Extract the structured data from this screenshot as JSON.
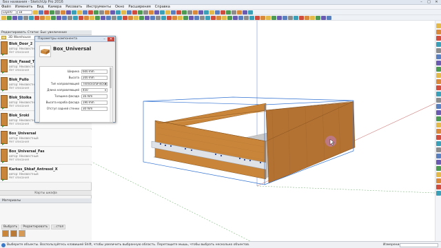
{
  "window": {
    "title": "Без названия - SketchUp Pro 2016",
    "controls": [
      "–",
      "□",
      "✕"
    ]
  },
  "menu": [
    "Файл",
    "Изменить",
    "Вид",
    "Камера",
    "Рисовать",
    "Инструменты",
    "Окно",
    "Расширения",
    "Справка"
  ],
  "toolbar": {
    "layer_select": "Layer0",
    "value_select": "18",
    "icon_colors": [
      "#e2b94a",
      "#5a7fbf",
      "#cf4d3f",
      "#4f9a52",
      "#8c8c8c",
      "#d9893b",
      "#6a5ab0",
      "#3c9fb8"
    ]
  },
  "left_panel": {
    "tabs": [
      "Редактировать",
      "Статис",
      "Быс увеличение"
    ],
    "path": "3D Warehouse",
    "components": [
      {
        "name": "Blok_Door_2",
        "author": "автор: Неизвестный",
        "description": "Нет описания"
      },
      {
        "name": "Blok_Fasad_T",
        "author": "автор: Неизвестный",
        "description": "Нет описания"
      },
      {
        "name": "Blok_Pullo",
        "author": "автор: Неизвестный",
        "description": "Нет описания"
      },
      {
        "name": "Blok_Stoika",
        "author": "автор: Неизвестный",
        "description": "Нет описания"
      },
      {
        "name": "Blok_Sroki",
        "author": "автор: Неизвестный",
        "description": "Нет описания"
      },
      {
        "name": "Box_Universal",
        "author": "автор: Неизвестный",
        "description": "Нет описания"
      },
      {
        "name": "Box_Universal_Fas",
        "author": "автор: Неизвестный",
        "description": "Нет описания"
      },
      {
        "name": "Karkas_Shkaf_Antresol_X",
        "author": "автор: Неизвестный",
        "description": "Нет описания"
      }
    ],
    "map_label": "Карты шкафа",
    "materials_header": "Материалы",
    "material_tabs": [
      "Выбрать",
      "Редактировать"
    ],
    "material_search": "...стол",
    "swatch_colors": [
      "#c9863b",
      "#b97a38",
      "#d59a55"
    ]
  },
  "dialog": {
    "title": "Параметры компонента",
    "close": "✕",
    "minimize": "–",
    "component_name": "Box_Universal",
    "params": [
      {
        "label": "Ширина",
        "value": "600 mm",
        "dropdown": false
      },
      {
        "label": "Высота",
        "value": "200 mm",
        "dropdown": false
      },
      {
        "label": "Тип направляющей",
        "value": "Телескопическая",
        "dropdown": true
      },
      {
        "label": "Длина направляющей",
        "value": "450",
        "dropdown": true
      },
      {
        "label": "Толщина фасада",
        "value": "16 mm",
        "dropdown": false
      },
      {
        "label": "Высота короба фасада",
        "value": "190 mm",
        "dropdown": false
      },
      {
        "label": "Отступ задней стенки",
        "value": "30 mm",
        "dropdown": false
      }
    ]
  },
  "status": {
    "message": "Выберите объекты. Воспользуйтесь клавишей Shift, чтобы увеличить выбранную область. Перетащите мышь, чтобы выбрать несколько объектов.",
    "measure_label": "Измерения",
    "measure_value": ""
  },
  "colors": {
    "wood_light": "#c9863b",
    "wood_dark": "#a86a2c",
    "selection": "#2d6fd1",
    "cursor": "#c27fc9"
  }
}
